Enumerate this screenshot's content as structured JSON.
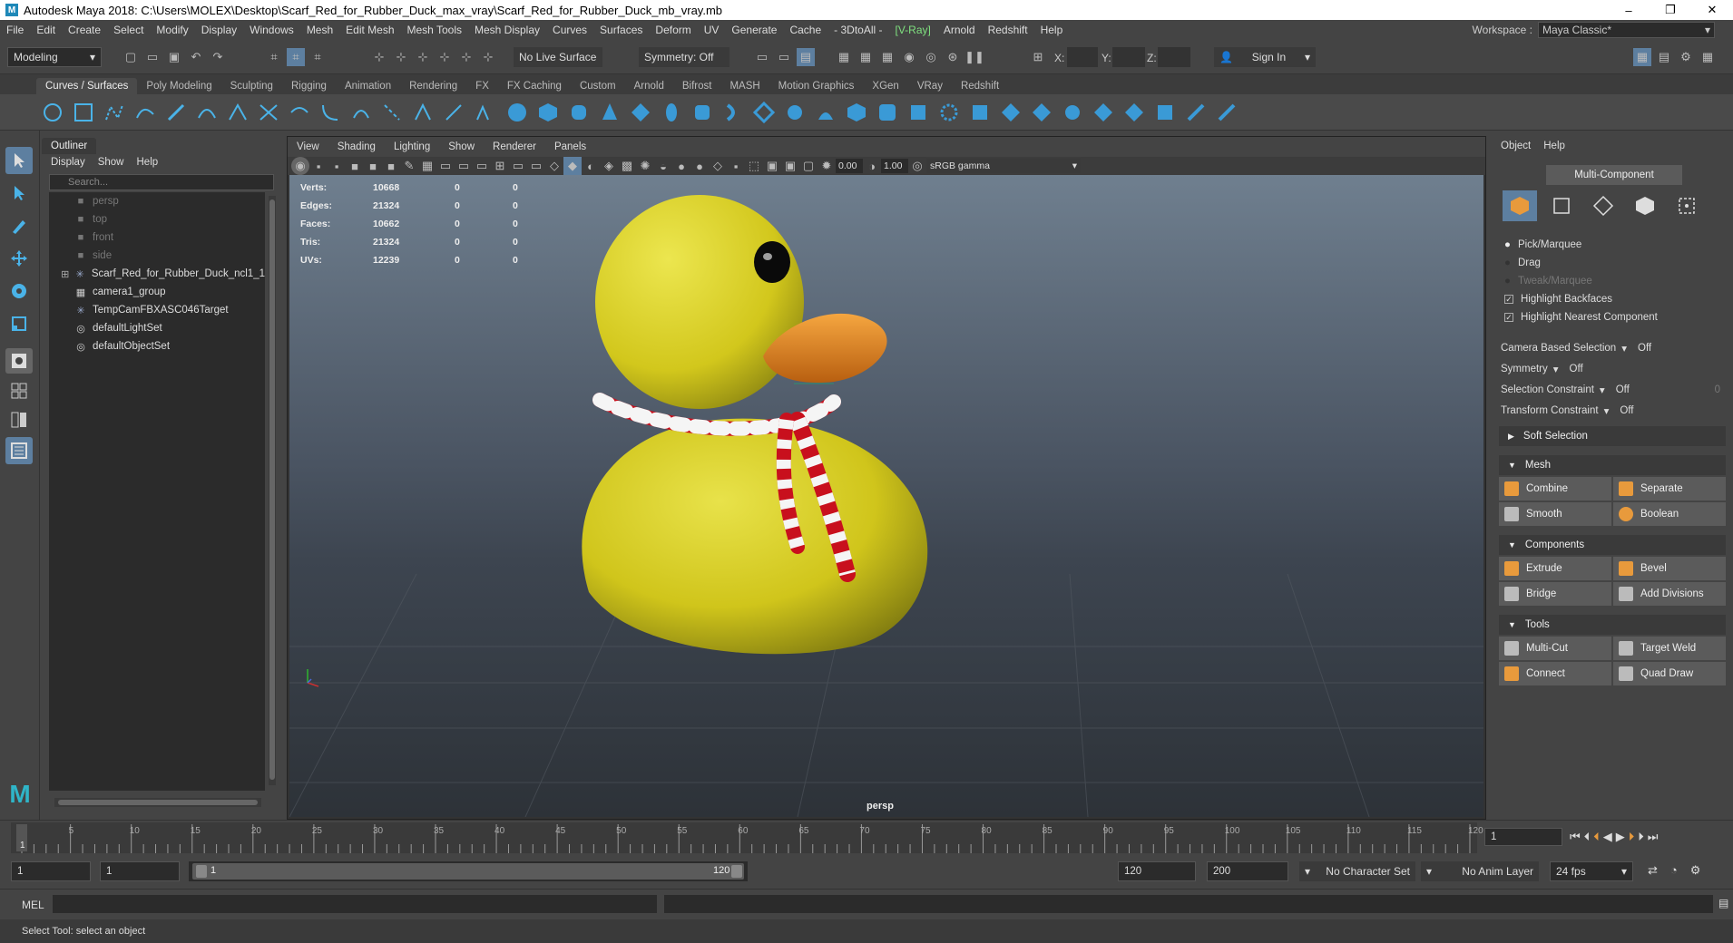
{
  "window": {
    "title": "Autodesk Maya 2018: C:\\Users\\MOLEX\\Desktop\\Scarf_Red_for_Rubber_Duck_max_vray\\Scarf_Red_for_Rubber_Duck_mb_vray.mb",
    "minimize": "–",
    "maximize": "❐",
    "close": "✕"
  },
  "menus": [
    "File",
    "Edit",
    "Create",
    "Select",
    "Modify",
    "Display",
    "Windows",
    "Mesh",
    "Edit Mesh",
    "Mesh Tools",
    "Mesh Display",
    "Curves",
    "Surfaces",
    "Deform",
    "UV",
    "Generate",
    "Cache",
    "- 3DtoAll -",
    "V-Ray",
    "Arnold",
    "Redshift",
    "Help"
  ],
  "workspace": {
    "label": "Workspace :",
    "value": "Maya Classic*"
  },
  "status": {
    "mode": "Modeling",
    "live_surface": "No Live Surface",
    "symmetry": "Symmetry: Off",
    "x_label": "X:",
    "y_label": "Y:",
    "z_label": "Z:",
    "sign_in": "Sign In"
  },
  "shelf_tabs": [
    "Curves / Surfaces",
    "Poly Modeling",
    "Sculpting",
    "Rigging",
    "Animation",
    "Rendering",
    "FX",
    "FX Caching",
    "Custom",
    "Arnold",
    "Bifrost",
    "MASH",
    "Motion Graphics",
    "XGen",
    "VRay",
    "Redshift"
  ],
  "outliner": {
    "tab": "Outliner",
    "menu": [
      "Display",
      "Show",
      "Help"
    ],
    "search_placeholder": "Search...",
    "items": [
      {
        "label": "persp",
        "dim": true
      },
      {
        "label": "top",
        "dim": true
      },
      {
        "label": "front",
        "dim": true
      },
      {
        "label": "side",
        "dim": true
      },
      {
        "label": "Scarf_Red_for_Rubber_Duck_ncl1_1",
        "dim": false
      },
      {
        "label": "camera1_group",
        "dim": false
      },
      {
        "label": "TempCamFBXASC046Target",
        "dim": false
      },
      {
        "label": "defaultLightSet",
        "dim": false
      },
      {
        "label": "defaultObjectSet",
        "dim": false
      }
    ]
  },
  "viewport": {
    "menu": [
      "View",
      "Shading",
      "Lighting",
      "Show",
      "Renderer",
      "Panels"
    ],
    "near": "0.00",
    "far": "1.00",
    "color_space": "sRGB gamma",
    "camera": "persp",
    "hud": [
      {
        "label": "Verts:",
        "v": "10668",
        "a": "0",
        "b": "0"
      },
      {
        "label": "Edges:",
        "v": "21324",
        "a": "0",
        "b": "0"
      },
      {
        "label": "Faces:",
        "v": "10662",
        "a": "0",
        "b": "0"
      },
      {
        "label": "Tris:",
        "v": "21324",
        "a": "0",
        "b": "0"
      },
      {
        "label": "UVs:",
        "v": "12239",
        "a": "0",
        "b": "0"
      }
    ]
  },
  "modeling_toolkit": {
    "menu": [
      "Object",
      "Help"
    ],
    "mode_button": "Multi-Component",
    "pick_marquee": "Pick/Marquee",
    "drag": "Drag",
    "tweak_marquee": "Tweak/Marquee",
    "highlight_backfaces": "Highlight Backfaces",
    "highlight_nearest": "Highlight Nearest Component",
    "camera_based": {
      "label": "Camera Based Selection",
      "value": "Off"
    },
    "symmetry": {
      "label": "Symmetry",
      "value": "Off"
    },
    "selection_constraint": {
      "label": "Selection Constraint",
      "value": "Off",
      "extra": "0"
    },
    "transform_constraint": {
      "label": "Transform Constraint",
      "value": "Off"
    },
    "soft_selection": "Soft Selection",
    "sections": {
      "mesh": {
        "title": "Mesh",
        "buttons": [
          "Combine",
          "Separate",
          "Smooth",
          "Boolean"
        ]
      },
      "components": {
        "title": "Components",
        "buttons": [
          "Extrude",
          "Bevel",
          "Bridge",
          "Add Divisions"
        ]
      },
      "tools": {
        "title": "Tools",
        "buttons": [
          "Multi-Cut",
          "Target Weld",
          "Connect",
          "Quad Draw"
        ]
      }
    }
  },
  "timeline": {
    "ticks": [
      "5",
      "10",
      "15",
      "20",
      "25",
      "30",
      "35",
      "40",
      "45",
      "50",
      "55",
      "60",
      "65",
      "70",
      "75",
      "80",
      "85",
      "90",
      "95",
      "100",
      "105",
      "110",
      "115",
      "120"
    ],
    "current_marker": "1",
    "current": "1"
  },
  "range": {
    "start": "1",
    "inner_start": "1",
    "slider_start": "1",
    "slider_end": "120",
    "end": "120",
    "max": "200",
    "character_set": "No Character Set",
    "anim_layer": "No Anim Layer",
    "fps": "24 fps"
  },
  "cmd": {
    "label": "MEL"
  },
  "help": "Select Tool: select an object"
}
